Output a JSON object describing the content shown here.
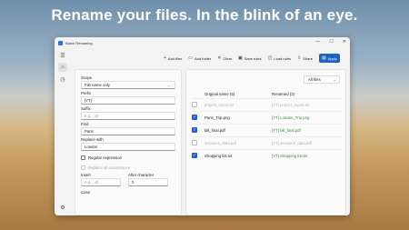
{
  "headline": "Rename your files. In the blink of an eye.",
  "window": {
    "title": "Batch Renaming",
    "controls": {
      "minimize": "—",
      "maximize": "☐",
      "close": "✕"
    }
  },
  "rail": {
    "menu_icon": "☰",
    "home_icon": "⌂",
    "history_icon": "◷",
    "settings_icon": "⚙"
  },
  "toolbar": {
    "add_files": "Add files",
    "add_folder": "Add folder",
    "clear": "Clear",
    "save_rules": "Save rules",
    "load_rules": "Load rules",
    "share": "Share",
    "apply": "Apply"
  },
  "options": {
    "scope_label": "Scope",
    "scope_value": "File name only",
    "prefix_label": "Prefix",
    "prefix_value": "[YT]",
    "suffix_label": "Suffix",
    "suffix_placeholder": "e.g. _v2",
    "find_label": "Find",
    "find_value": "Paris",
    "replace_label": "Replace with",
    "replace_value": "London",
    "regex_label": "Regular expression",
    "replace_all_label": "Replace all occurrences",
    "insert_label": "Insert",
    "insert_placeholder": "e.g. _v2",
    "after_char_label": "After character",
    "after_char_value": "0",
    "case_label": "Case"
  },
  "files": {
    "filter_value": "All files",
    "col_original": "Original name (5)",
    "col_renamed": "Renamed (3)",
    "rows": [
      {
        "checked": false,
        "original": "project_report.txt",
        "renamed": "[YT] project_report.txt"
      },
      {
        "checked": true,
        "original": "Paris_Trip.png",
        "renamed": "[YT] London_Trip.png"
      },
      {
        "checked": true,
        "original": "bill_final.pdf",
        "renamed": "[YT] bill_final.pdf"
      },
      {
        "checked": false,
        "original": "session2_data.pdf",
        "renamed": "[YT] session2_data.pdf"
      },
      {
        "checked": true,
        "original": "Shopping list.txt",
        "renamed": "[YT] Shopping list.txt"
      }
    ]
  },
  "colors": {
    "accent": "#1c63c4",
    "renamed_green": "#3f8a3a"
  }
}
